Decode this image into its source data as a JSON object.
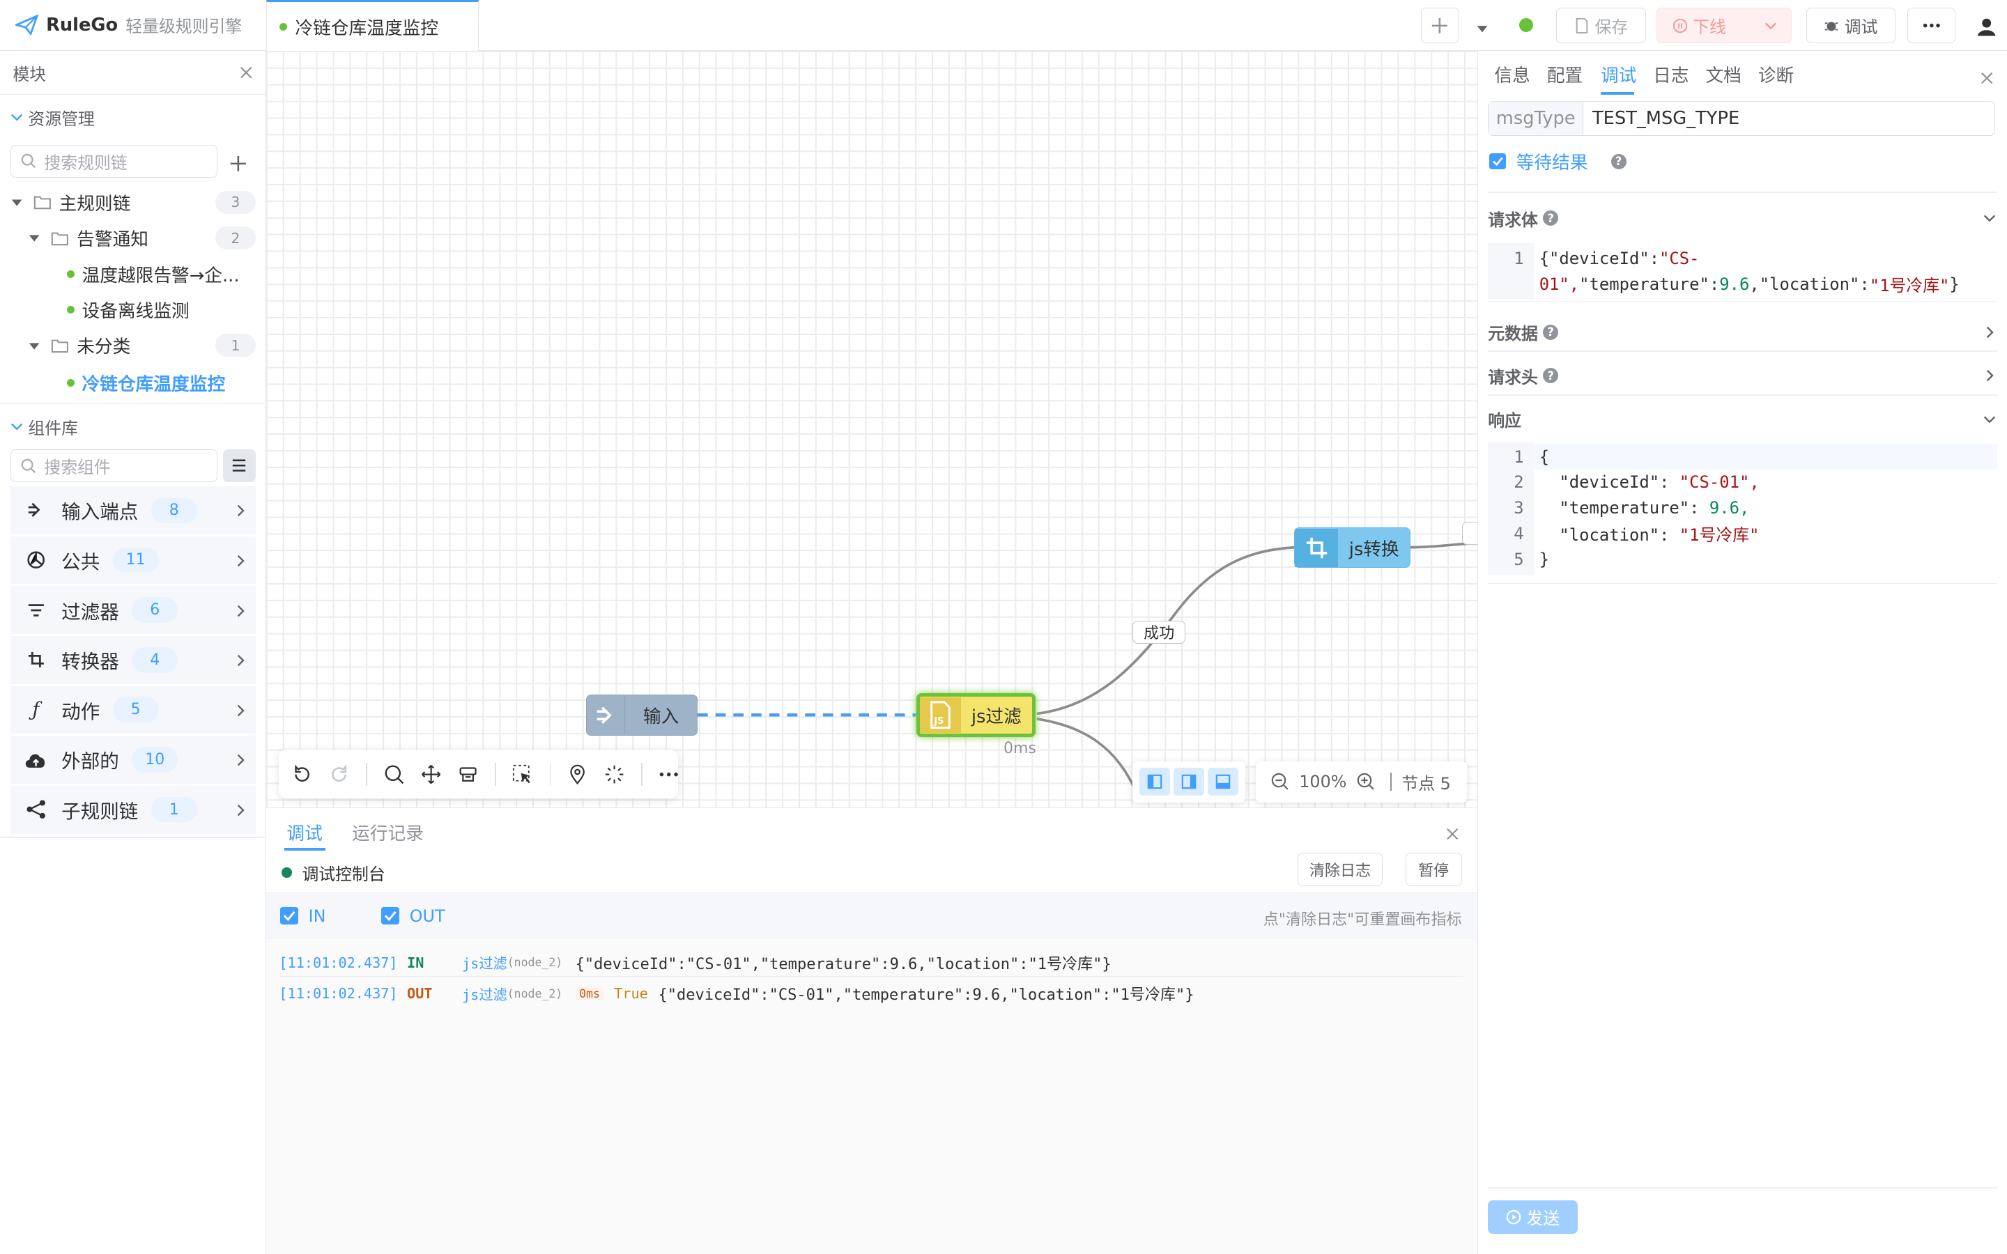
{
  "app": {
    "brand": "RuleGo",
    "subtitle": "轻量级规则引擎"
  },
  "tab": {
    "title": "冷链仓库温度监控"
  },
  "toolbar": {
    "save": "保存",
    "offline": "下线",
    "debug": "调试"
  },
  "left": {
    "header": "模块",
    "resource_section": "资源管理",
    "search_chain_placeholder": "搜索规则链",
    "tree": [
      {
        "label": "主规则链",
        "count": "3"
      },
      {
        "label": "告警通知",
        "count": "2"
      },
      {
        "label": "温度越限告警→企..."
      },
      {
        "label": "设备离线监测"
      },
      {
        "label": "未分类",
        "count": "1"
      },
      {
        "label": "冷链仓库温度监控"
      }
    ],
    "component_section": "组件库",
    "search_component_placeholder": "搜索组件",
    "components": [
      {
        "label": "输入端点",
        "count": "8",
        "icon": "input-endpoint-icon"
      },
      {
        "label": "公共",
        "count": "11",
        "icon": "common-icon"
      },
      {
        "label": "过滤器",
        "count": "6",
        "icon": "filter-icon"
      },
      {
        "label": "转换器",
        "count": "4",
        "icon": "transform-icon"
      },
      {
        "label": "动作",
        "count": "5",
        "icon": "function-icon"
      },
      {
        "label": "外部的",
        "count": "10",
        "icon": "cloud-upload-icon"
      },
      {
        "label": "子规则链",
        "count": "1",
        "icon": "share-icon"
      }
    ]
  },
  "canvas": {
    "nodes": {
      "input": "输入",
      "js_filter": "js过滤",
      "js_transform": "js转换"
    },
    "edge_label": "成功",
    "timing": "0ms",
    "zoom": "100%",
    "node_count": "节点 5"
  },
  "debug": {
    "tabs": [
      "调试",
      "运行记录"
    ],
    "console_title": "调试控制台",
    "clear_log": "清除日志",
    "pause": "暂停",
    "filter_in": "IN",
    "filter_out": "OUT",
    "hint": "点\"清除日志\"可重置画布指标",
    "logs": [
      {
        "time": "[11:01:02.437]",
        "dir": "IN",
        "node": "js过滤",
        "node_id": "(node_2)",
        "ms": "",
        "result": "",
        "payload": "{\"deviceId\":\"CS-01\",\"temperature\":9.6,\"location\":\"1号冷库\"}"
      },
      {
        "time": "[11:01:02.437]",
        "dir": "OUT",
        "node": "js过滤",
        "node_id": "(node_2)",
        "ms": "0ms",
        "result": "True",
        "payload": "{\"deviceId\":\"CS-01\",\"temperature\":9.6,\"location\":\"1号冷库\"}"
      }
    ]
  },
  "right": {
    "tabs": [
      "信息",
      "配置",
      "调试",
      "日志",
      "文档",
      "诊断"
    ],
    "active_tab": "调试",
    "msgtype_label": "msgType",
    "msgtype_value": "TEST_MSG_TYPE",
    "wait_result": "等待结果",
    "request_body_label": "请求体",
    "request_body": {
      "line1a": "{\"deviceId\":\"CS-",
      "line1b": "01\",\"temperature\":9.6,\"location\":\"1号冷库\"}"
    },
    "metadata_label": "元数据",
    "headers_label": "请求头",
    "response_label": "响应",
    "response_lines": [
      "{",
      "  \"deviceId\": \"CS-01\",",
      "  \"temperature\": 9.6,",
      "  \"location\": \"1号冷库\"",
      "}"
    ],
    "send": "发送"
  },
  "colors": {
    "accent": "#409eff",
    "success": "#67c23a",
    "danger": "#f56c6c",
    "filter_node": "#f4e46b",
    "transform_node": "#7ec8ef",
    "input_node": "#9fb3c8"
  }
}
